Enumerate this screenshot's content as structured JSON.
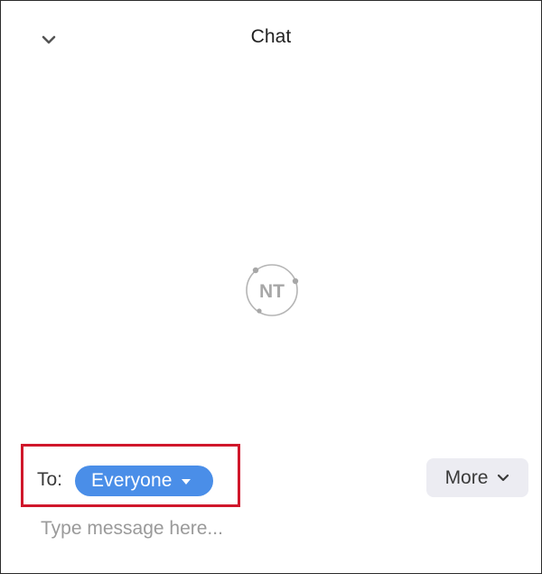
{
  "header": {
    "title": "Chat",
    "collapse_icon": "chevron-down-icon"
  },
  "watermark": {
    "text": "NT",
    "icon": "logo-icon"
  },
  "recipient": {
    "to_label": "To:",
    "selected": "Everyone",
    "dropdown_icon": "caret-down-icon",
    "highlight_color": "#d0172b",
    "pill_color": "#4a8ee8"
  },
  "toolbar": {
    "more_label": "More",
    "more_icon": "chevron-down-icon"
  },
  "composer": {
    "placeholder": "Type message here...",
    "value": ""
  }
}
